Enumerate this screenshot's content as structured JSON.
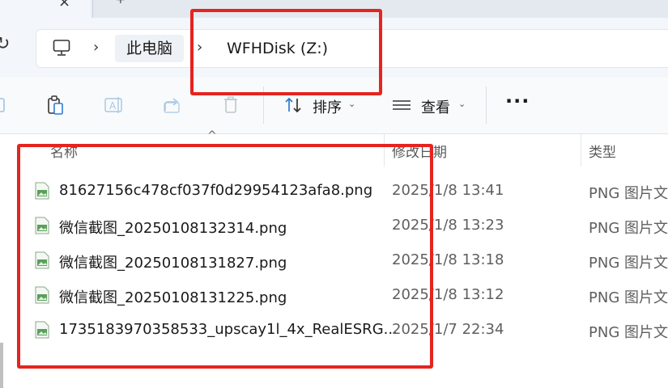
{
  "tabbar": {
    "close_glyph": "×",
    "next_tab_glyph": "+"
  },
  "address": {
    "refresh_glyph": "↻",
    "pc_icon": "monitor-icon",
    "separator": "›",
    "crumbs": [
      "此电脑",
      "WFHDisk (Z:)"
    ]
  },
  "toolbar": {
    "icons": [
      "copy-icon",
      "paste-icon",
      "rename-icon",
      "share-icon",
      "delete-icon"
    ],
    "sort_label": "排序",
    "view_label": "查看",
    "caret": "⌄",
    "more_label": "···"
  },
  "list": {
    "columns": [
      "名称",
      "修改日期",
      "类型"
    ],
    "sort_glyph": "^",
    "rows": [
      {
        "name": "81627156c478cf037f0d29954123afa8.png",
        "date": "2025/1/8 13:41",
        "type": "PNG 图片文"
      },
      {
        "name": "微信截图_20250108132314.png",
        "date": "2025/1/8 13:23",
        "type": "PNG 图片文"
      },
      {
        "name": "微信截图_20250108131827.png",
        "date": "2025/1/8 13:18",
        "type": "PNG 图片文"
      },
      {
        "name": "微信截图_20250108131225.png",
        "date": "2025/1/8 13:12",
        "type": "PNG 图片文"
      },
      {
        "name": "1735183970358533_upscay1l_4x_RealESRG...",
        "date": "2025/1/7 22:34",
        "type": "PNG 图片文"
      }
    ]
  },
  "colors": {
    "annotation": "#e52420",
    "file_icon": "#5aa05a"
  }
}
